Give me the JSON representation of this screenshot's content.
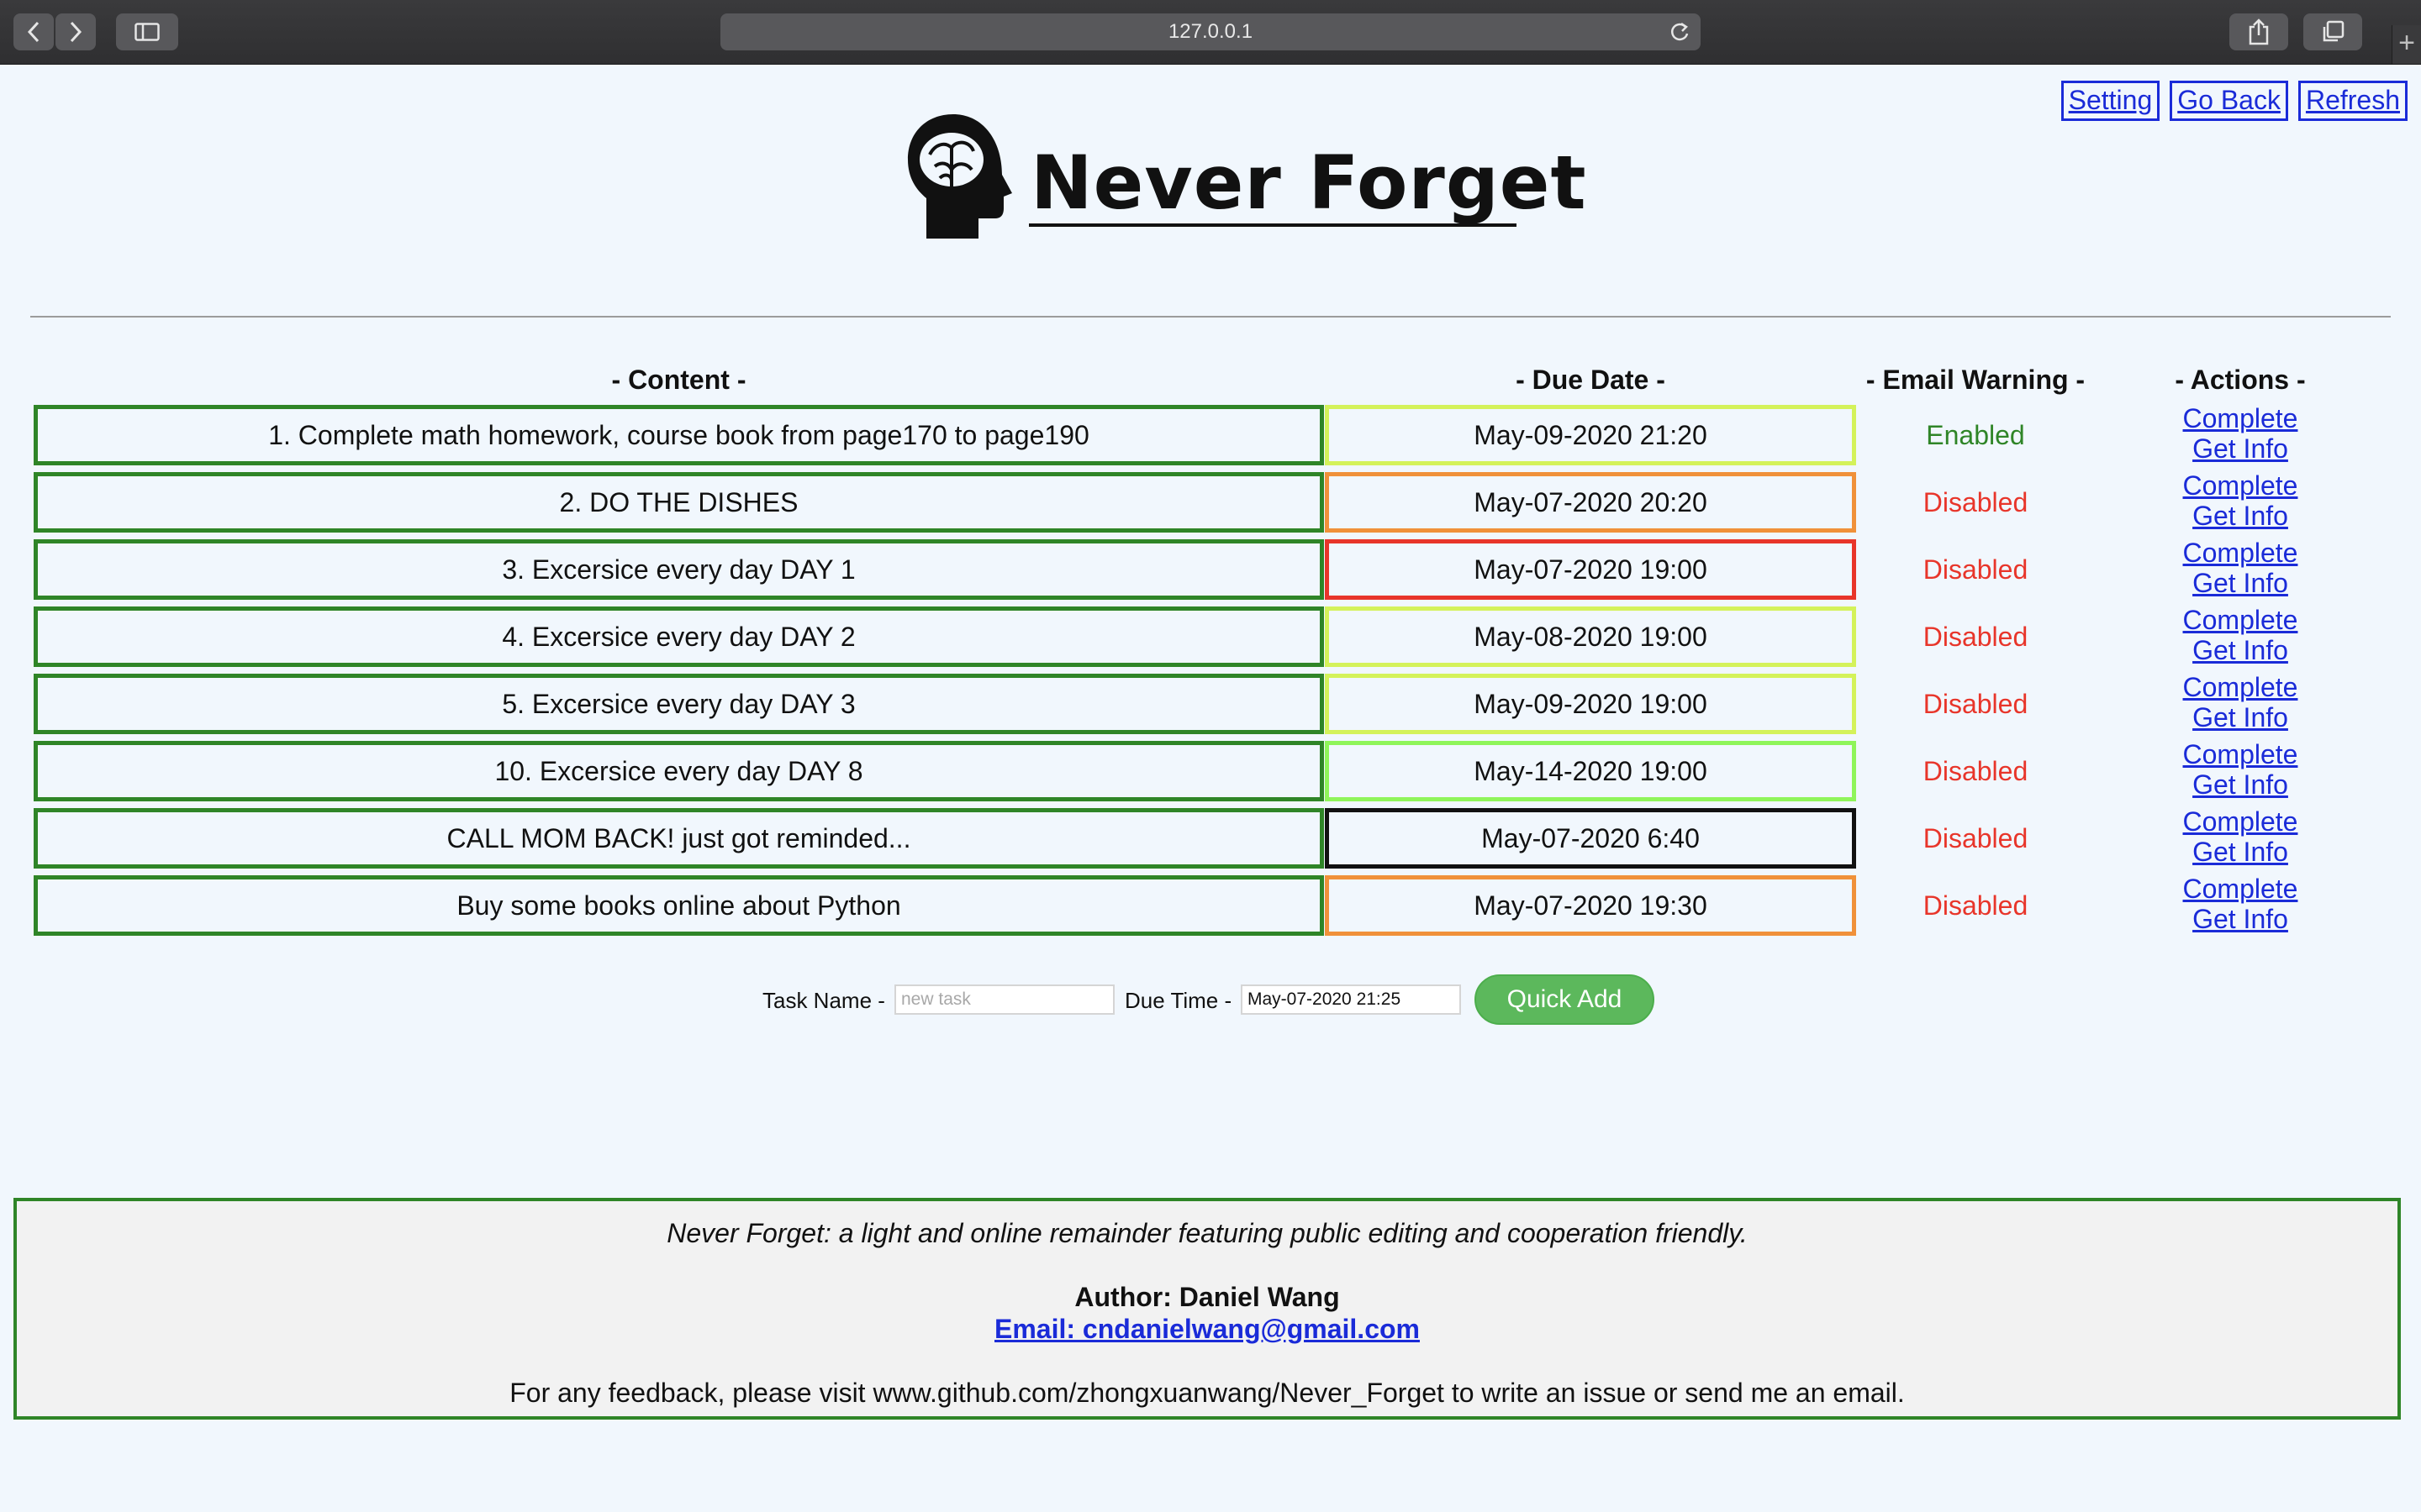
{
  "browser": {
    "url": "127.0.0.1",
    "icons": [
      "back-icon",
      "forward-icon",
      "sidebar-icon",
      "reload-icon",
      "share-icon",
      "tabs-icon",
      "new-tab-icon"
    ]
  },
  "nav": {
    "setting": "Setting",
    "go_back": "Go Back",
    "refresh": "Refresh"
  },
  "logo": {
    "title": "Never Forget",
    "icon": "brain-head-icon"
  },
  "table": {
    "headers": {
      "content": "- Content -",
      "due_date": "- Due Date -",
      "email_warning": "- Email Warning -",
      "actions": "- Actions -"
    },
    "rows": [
      {
        "content": "1. Complete math homework, course book from page170 to page190",
        "due": "May-09-2020 21:20",
        "due_color": "#d4f25a",
        "email": "Enabled",
        "complete": "Complete",
        "info": "Get Info"
      },
      {
        "content": "2. DO THE DISHES",
        "due": "May-07-2020 20:20",
        "due_color": "#f0913a",
        "email": "Disabled",
        "complete": "Complete",
        "info": "Get Info"
      },
      {
        "content": "3. Excersice every day DAY 1",
        "due": "May-07-2020 19:00",
        "due_color": "#e8352a",
        "email": "Disabled",
        "complete": "Complete",
        "info": "Get Info"
      },
      {
        "content": "4. Excersice every day DAY 2",
        "due": "May-08-2020 19:00",
        "due_color": "#d4f25a",
        "email": "Disabled",
        "complete": "Complete",
        "info": "Get Info"
      },
      {
        "content": "5. Excersice every day DAY 3",
        "due": "May-09-2020 19:00",
        "due_color": "#d4f25a",
        "email": "Disabled",
        "complete": "Complete",
        "info": "Get Info"
      },
      {
        "content": "10. Excersice every day DAY 8",
        "due": "May-14-2020 19:00",
        "due_color": "#8ff55a",
        "email": "Disabled",
        "complete": "Complete",
        "info": "Get Info"
      },
      {
        "content": "CALL MOM BACK! just got reminded...",
        "due": "May-07-2020 6:40",
        "due_color": "#111111",
        "email": "Disabled",
        "complete": "Complete",
        "info": "Get Info"
      },
      {
        "content": "Buy some books online about Python",
        "due": "May-07-2020 19:30",
        "due_color": "#f0913a",
        "email": "Disabled",
        "complete": "Complete",
        "info": "Get Info"
      }
    ],
    "colors": {
      "enabled": "#2f8527",
      "disabled": "#e8352a",
      "content_border": "#2f8527"
    }
  },
  "quick_add": {
    "task_label": "Task Name -",
    "task_placeholder": "new task",
    "due_label": "Due Time -",
    "due_value": "May-07-2020 21:25",
    "button": "Quick Add"
  },
  "footer": {
    "tagline": "Never Forget: a light and online remainder featuring public editing and cooperation friendly.",
    "author": "Author: Daniel Wang",
    "email": "Email: cndanielwang@gmail.com",
    "feedback": "For any feedback, please visit www.github.com/zhongxuanwang/Never_Forget to write an issue or send me an email."
  }
}
